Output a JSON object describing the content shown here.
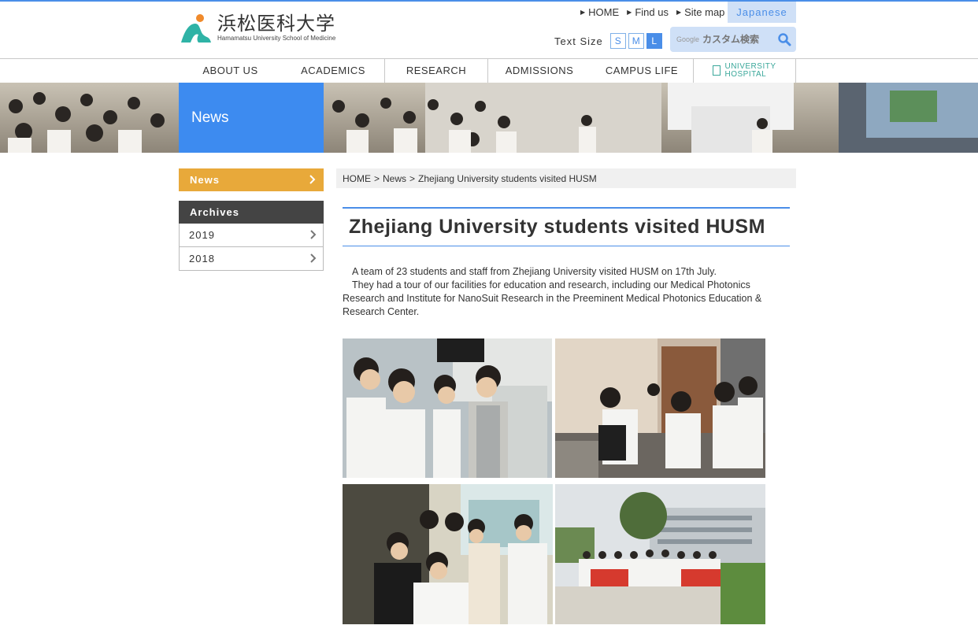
{
  "header": {
    "logo_jp": "浜松医科大学",
    "logo_en": "Hamamatsu University School of Medicine",
    "util_links": [
      {
        "label": "HOME"
      },
      {
        "label": "Find us"
      },
      {
        "label": "Site map"
      }
    ],
    "language_button": "Japanese",
    "text_size_label": "Text Size",
    "text_size_options": [
      "S",
      "M",
      "L"
    ],
    "text_size_selected": "L",
    "search_brand": "Google",
    "search_placeholder": "カスタム検索"
  },
  "nav": {
    "items": [
      {
        "label": "ABOUT US"
      },
      {
        "label": "ACADEMICS"
      },
      {
        "label": "RESEARCH"
      },
      {
        "label": "ADMISSIONS"
      },
      {
        "label": "CAMPUS LIFE"
      }
    ],
    "hospital_line1": "UNIVERSITY",
    "hospital_line2": "HOSPITAL"
  },
  "banner": {
    "title": "News"
  },
  "sidebar": {
    "current": "News",
    "archives_heading": "Archives",
    "archive_years": [
      "2019",
      "2018"
    ]
  },
  "breadcrumb": {
    "home": "HOME",
    "sep": ">",
    "news": "News",
    "current": "Zhejiang University students visited HUSM"
  },
  "article": {
    "title": "Zhejiang University students visited HUSM",
    "paragraphs": [
      "A team of 23 students and staff from Zhejiang University visited HUSM on 17th July.",
      "They had a tour of our facilities for education and research, including our Medical Photonics Research and Institute for NanoSuit Research in the Preeminent Medical Photonics Education & Research Center."
    ]
  },
  "colors": {
    "accent_blue": "#4a8ee8",
    "news_orange": "#e8a93a",
    "archives_dark": "#444444",
    "hospital_teal": "#3aa79a"
  },
  "icons": {
    "util_arrow": "triangle-right-icon",
    "search": "magnifier-icon",
    "chevron": "chevron-right-icon",
    "hospital": "hospital-building-icon"
  }
}
